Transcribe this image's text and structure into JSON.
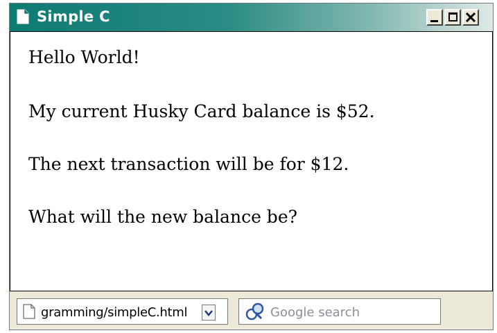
{
  "window": {
    "title": "Simple C",
    "controls": [
      "minimize",
      "maximize",
      "close"
    ]
  },
  "content": {
    "paragraphs": [
      "Hello World!",
      "My current Husky Card balance is $52.",
      "The next transaction will be for $12.",
      "What will the new balance be?"
    ]
  },
  "statusbar": {
    "url_value": "gramming/simpleC.html",
    "search_placeholder": "Google search"
  },
  "icons": {
    "title": "page-icon",
    "url": "page-icon",
    "dropdown": "chevron-down-icon",
    "search": "search-icon"
  }
}
